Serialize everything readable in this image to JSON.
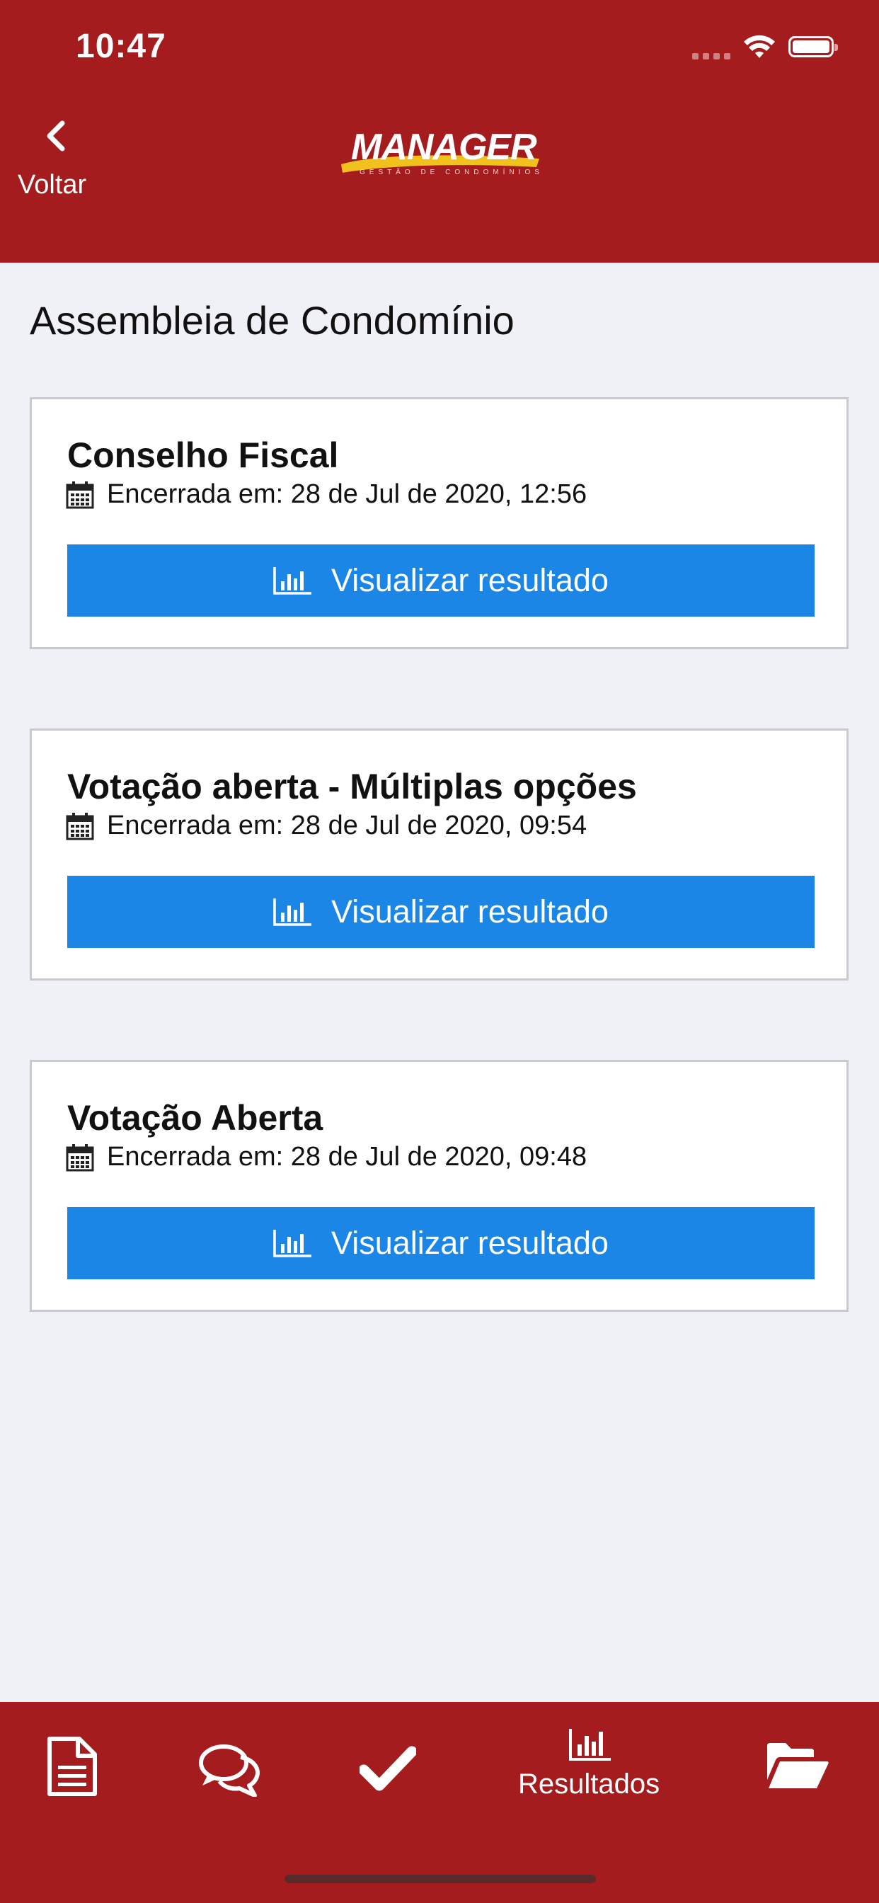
{
  "status_bar": {
    "time": "10:47"
  },
  "header": {
    "back_label": "Voltar",
    "logo_text": "MANAGER",
    "logo_subtitle": "GESTÃO DE CONDOMÍNIOS"
  },
  "page": {
    "title": "Assembleia de Condomínio"
  },
  "cards": [
    {
      "title": "Conselho Fiscal",
      "date": "Encerrada em: 28 de Jul de 2020, 12:56",
      "button_label": "Visualizar resultado"
    },
    {
      "title": "Votação aberta - Múltiplas opções",
      "date": "Encerrada em: 28 de Jul de 2020, 09:54",
      "button_label": "Visualizar resultado"
    },
    {
      "title": "Votação Aberta",
      "date": "Encerrada em: 28 de Jul de 2020, 09:48",
      "button_label": "Visualizar resultado"
    }
  ],
  "bottom_nav": {
    "items": [
      {
        "icon": "document-icon"
      },
      {
        "icon": "chat-icon"
      },
      {
        "icon": "check-icon"
      },
      {
        "icon": "bar-chart-icon",
        "label": "Resultados",
        "active": true
      },
      {
        "icon": "folder-open-icon"
      }
    ]
  },
  "colors": {
    "brand": "#a51c1f",
    "button": "#1b86e6",
    "background": "#f0f1f6"
  }
}
